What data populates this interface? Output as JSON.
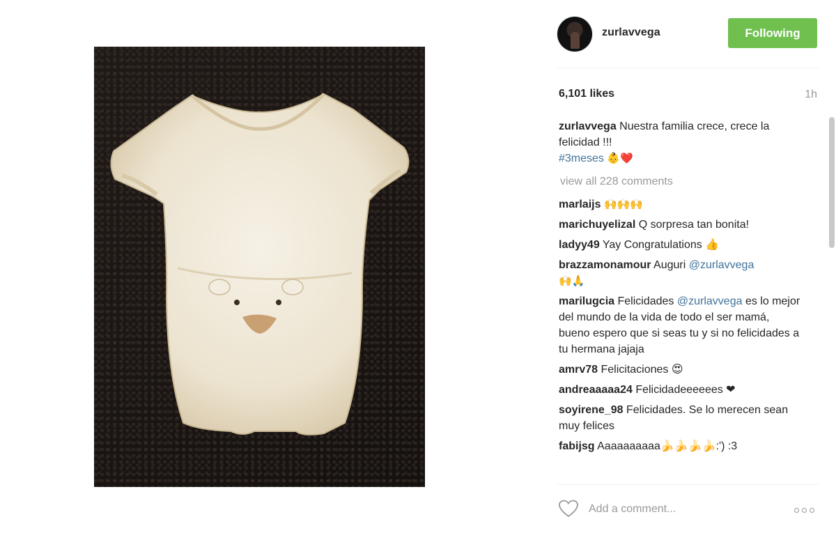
{
  "post": {
    "username": "zurlavvega",
    "follow_label": "Following",
    "likes": "6,101 likes",
    "time_ago": "1h",
    "caption": {
      "author": "zurlavvega",
      "text": "Nuestra familia crece, crece la felicidad !!!",
      "hashtag": "#3meses",
      "emojis": "👶❤️"
    },
    "view_all": "view all 228 comments",
    "comments": [
      {
        "author": "marlaijs",
        "text": "🙌🙌🙌",
        "mention": "",
        "after": ""
      },
      {
        "author": "marichuyelizal",
        "text": "Q sorpresa tan bonita!",
        "mention": "",
        "after": ""
      },
      {
        "author": "ladyy49",
        "text": "Yay Congratulations 👍",
        "mention": "",
        "after": ""
      },
      {
        "author": "brazzamonamour",
        "text": "Auguri",
        "mention": "@zurlavvega",
        "after": "🙌🙏"
      },
      {
        "author": "marilugcia",
        "text": "Felicidades",
        "mention": "@zurlavvega",
        "after": "es lo mejor del mundo de la vida de todo el ser mamá, bueno espero que si seas tu y si no felicidades a tu hermana jajaja"
      },
      {
        "author": "amrv78",
        "text": "Felicitaciones 😍",
        "mention": "",
        "after": ""
      },
      {
        "author": "andreaaaaa24",
        "text": "Felicidadeeeeees ❤",
        "mention": "",
        "after": ""
      },
      {
        "author": "soyirene_98",
        "text": "Felicidades. Se lo merecen sean muy felices",
        "mention": "",
        "after": ""
      },
      {
        "author": "fabijsg",
        "text": "Aaaaaaaaaa🍌🍌🍌🍌:') :3",
        "mention": "",
        "after": ""
      }
    ],
    "add_comment_placeholder": "Add a comment...",
    "colors": {
      "follow_button": "#70c050",
      "hashtag": "#3f729b",
      "muted": "#999999"
    },
    "icons": {
      "like": "heart-outline-icon",
      "more": "more-options-icon"
    }
  }
}
